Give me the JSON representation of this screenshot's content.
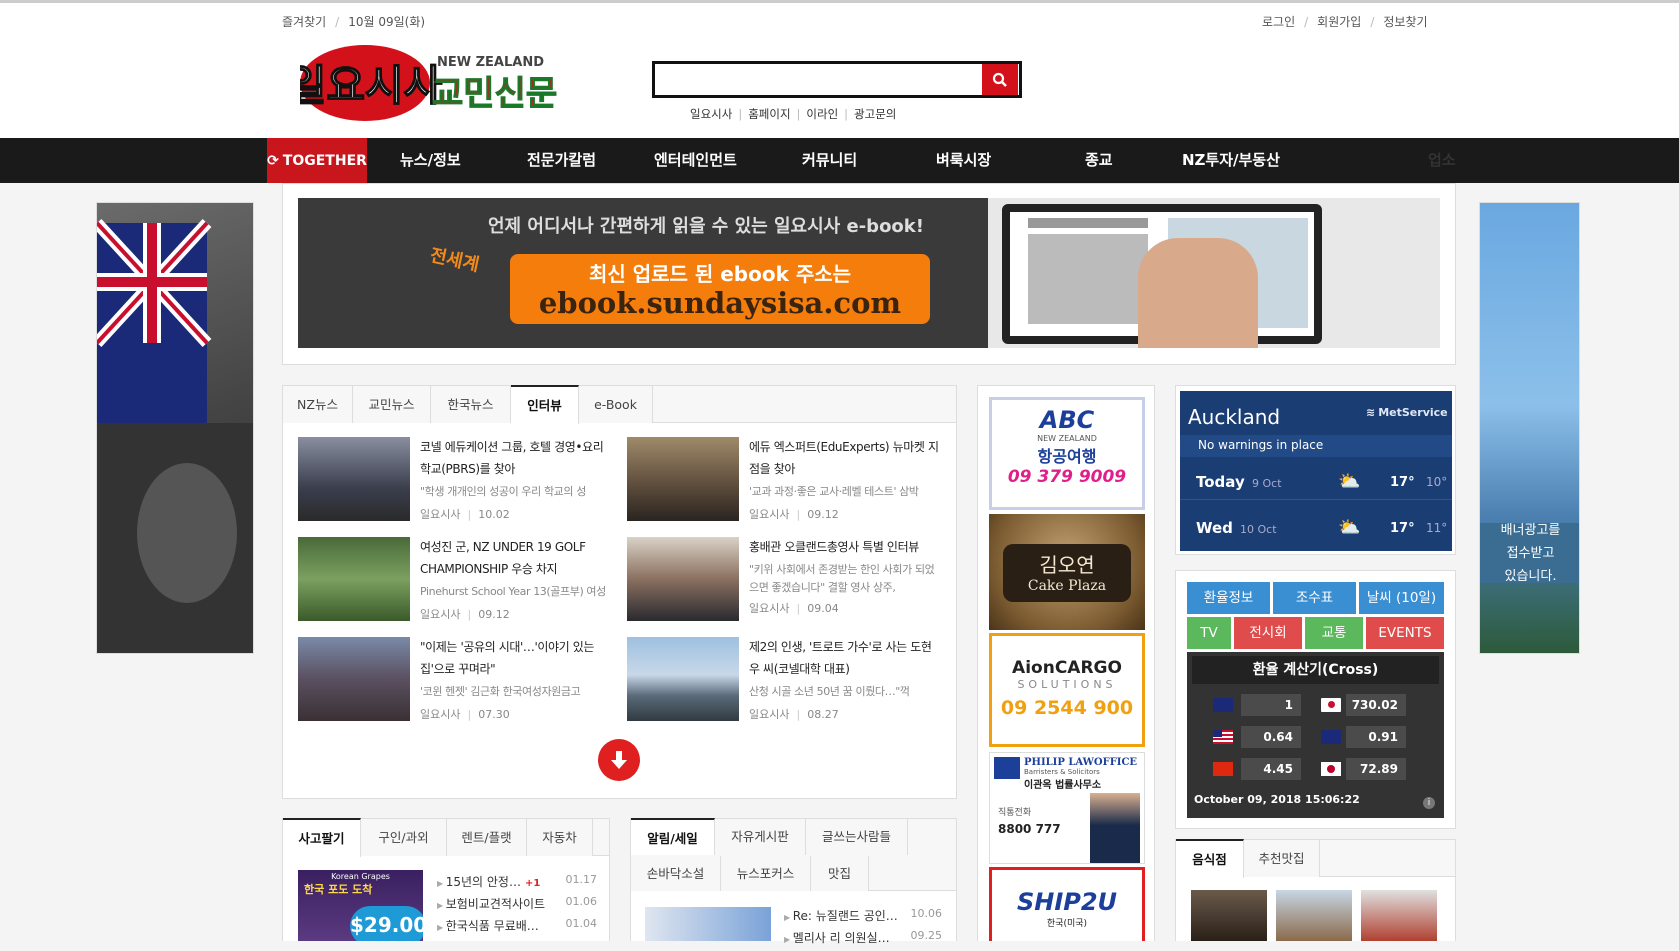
{
  "top": {
    "bookmark": "즐겨찾기",
    "date": "10월 09일(화)",
    "login": "로그인",
    "join": "회원가입",
    "find": "정보찾기"
  },
  "logo": {
    "main": "일요시사",
    "sub": "교민신문",
    "badge": "NEW ZEALAND"
  },
  "quicklinks": [
    "일요시사",
    "홈페이지",
    "이라인",
    "광고문의"
  ],
  "nav": {
    "together": "TOGETHER",
    "items": [
      "뉴스/정보",
      "전문가칼럼",
      "엔터테인먼트",
      "커뮤니티",
      "벼룩시장",
      "종교",
      "NZ투자/부동산",
      "업소"
    ]
  },
  "banner": {
    "top": "언제 어디서나 간편하게 읽을 수 있는 일요시사 e-book!",
    "side": "전세계",
    "btn1": "최신 업로드 된 ebook 주소는",
    "btn2": "ebook.sundaysisa.com"
  },
  "right_ad": {
    "line1": "배너광고를",
    "line2": "접수받고",
    "line3": "있습니다."
  },
  "news_tabs": [
    "NZ뉴스",
    "교민뉴스",
    "한국뉴스",
    "인터뷰",
    "e-Book"
  ],
  "news": [
    {
      "title": "코넬 에듀케이션 그룹, 호텔 경영•요리학교(PBRS)를 찾아",
      "summary": "\"학생 개개인의 성공이 우리 학교의 성",
      "source": "일요시사",
      "date": "10.02"
    },
    {
      "title": "에듀 엑스퍼트(EduExperts) 뉴마켓 지점을 찾아",
      "summary": "'교과 과정·좋은 교사·레벨 테스트' 삼박",
      "source": "일요시사",
      "date": "09.12"
    },
    {
      "title": "여성진 군, NZ UNDER 19 GOLF CHAMPIONSHIP 우승 차지",
      "summary": "Pinehurst School Year 13(골프부) 여성",
      "source": "일요시사",
      "date": "09.12"
    },
    {
      "title": "홍배관 오클랜드총영사 특별 인터뷰",
      "summary": "\"키위 사회에서 존경받는 한인 사회가 되었으면 좋겠습니다\" 결할 영사 상주,",
      "source": "일요시사",
      "date": "09.04"
    },
    {
      "title": "\"이제는 '공유의 시대'…'이야기 있는 집'으로 꾸며라\"",
      "summary": "'코윈 헨젯' 김근화 한국여성자원금고",
      "source": "일요시사",
      "date": "07.30"
    },
    {
      "title": "제2의 인생, '트로트 가수'로 사는 도현우 씨(코넬대학 대표)",
      "summary": "산청 시골 소년 50년 꿈 이뤘다…\"꺽",
      "source": "일요시사",
      "date": "08.27"
    }
  ],
  "ads": [
    {
      "name": "ABC",
      "sub": "NEW ZEALAND",
      "title": "항공여행",
      "phone": "09 379 9009"
    },
    {
      "name": "김오연",
      "sub": "Cake Plaza"
    },
    {
      "name": "AionCARGO",
      "sub": "SOLUTIONS",
      "phone": "09 2544 900"
    },
    {
      "name": "PHILIP LAWOFFICE",
      "sub": "Barristers & Solicitors",
      "title": "이관옥 법률사무소",
      "label": "직통전화",
      "phone": "8800 777"
    },
    {
      "name": "SHIP2U",
      "sub": "한국(미국)"
    }
  ],
  "weather": {
    "city": "Auckland",
    "provider": "MetService",
    "warning": "No warnings in place",
    "days": [
      {
        "day": "Today",
        "date": "9 Oct",
        "high": "17°",
        "low": "10°"
      },
      {
        "day": "Wed",
        "date": "10 Oct",
        "high": "17°",
        "low": "11°"
      }
    ]
  },
  "fx": {
    "buttons": [
      {
        "label": "환율정보",
        "color": "#3a8fd3"
      },
      {
        "label": "조수표",
        "color": "#3a8fd3"
      },
      {
        "label": "날씨 (10일)",
        "color": "#3a8fd3"
      },
      {
        "label": "TV",
        "color": "#5cb85c"
      },
      {
        "label": "전시회",
        "color": "#e04c4c"
      },
      {
        "label": "교통",
        "color": "#5cb85c"
      },
      {
        "label": "EVENTS",
        "color": "#e04c4c"
      }
    ],
    "title": "환율 계산기(Cross)",
    "rows": [
      {
        "a": "1",
        "b": "730.02"
      },
      {
        "a": "0.64",
        "b": "0.91"
      },
      {
        "a": "4.45",
        "b": "72.89"
      }
    ],
    "timestamp": "October 09, 2018 15:06:22"
  },
  "market_tabs": [
    "사고팔기",
    "구인/과외",
    "렌트/플랫",
    "자동차"
  ],
  "market_img": {
    "brand": "Korean Grapes",
    "title": "한국 포도 도착",
    "price": "$29.00"
  },
  "market_items": [
    {
      "title": "15년의 안정…",
      "badge": "+1",
      "date": "01.17"
    },
    {
      "title": "보험비교견적사이트",
      "date": "01.06"
    },
    {
      "title": "한국식품 무료배…",
      "date": "01.04"
    }
  ],
  "board_tabs": [
    "알림/세일",
    "자유게시판",
    "글쓰는사람들",
    "손바닥소설",
    "뉴스포커스",
    "맛집"
  ],
  "board_items": [
    {
      "title": "Re: 뉴질랜드 공인…",
      "date": "10.06"
    },
    {
      "title": "멜리사 리 의원실…",
      "date": "09.25"
    }
  ],
  "food_tabs": [
    "음식점",
    "추천맛집"
  ]
}
